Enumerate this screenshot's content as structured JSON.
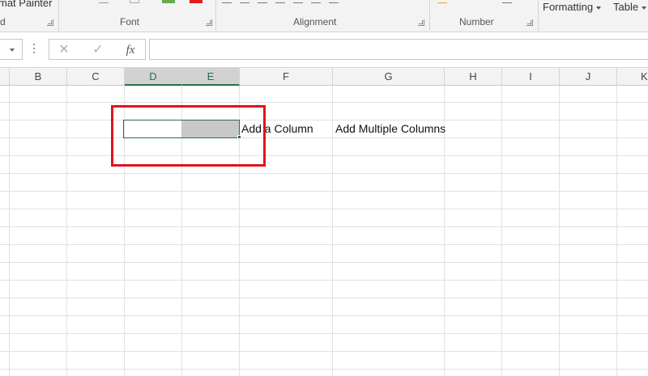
{
  "ribbon": {
    "clipboard_item": "mat Painter",
    "clipboard_label": "d",
    "font_label": "Font",
    "alignment_label": "Alignment",
    "number_label": "Number",
    "formatting_label": "Formatting",
    "table_label": "Table",
    "fill_color": "#6aa84f",
    "font_color": "#e31b1b"
  },
  "formula_bar": {
    "cancel_icon": "cancel-icon",
    "enter_icon": "check-icon",
    "fx_label": "fx",
    "value": ""
  },
  "columns": [
    "B",
    "C",
    "D",
    "E",
    "F",
    "G",
    "H",
    "I",
    "J",
    "K"
  ],
  "selected_columns": [
    "D",
    "E"
  ],
  "cells": {
    "F3": "Add a Column",
    "G3": "Add Multiple Columns"
  },
  "accent_color": "#217346",
  "highlight_color": "#e0141e"
}
